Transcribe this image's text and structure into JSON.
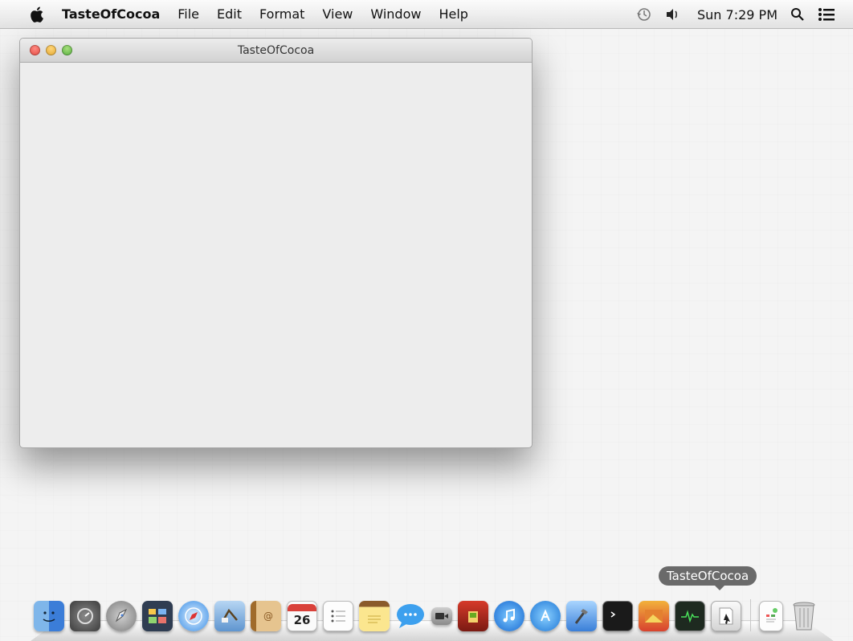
{
  "menubar": {
    "app_name": "TasteOfCocoa",
    "items": [
      "File",
      "Edit",
      "Format",
      "View",
      "Window",
      "Help"
    ],
    "clock": "Sun 7:29 PM"
  },
  "window": {
    "title": "TasteOfCocoa"
  },
  "dock": {
    "tooltip": "TasteOfCocoa",
    "calendar_day": "26",
    "icons": [
      "finder-icon",
      "dashboard-icon",
      "launchpad-icon",
      "mission-control-icon",
      "safari-icon",
      "mail-icon",
      "contacts-icon",
      "calendar-icon",
      "reminders-icon",
      "notes-icon",
      "messages-icon",
      "facetime-icon",
      "photo-booth-icon",
      "itunes-icon",
      "app-store-icon",
      "xcode-icon",
      "terminal-icon",
      "console-icon",
      "activity-monitor-icon",
      "tasteofcocoa-app-icon",
      "document-icon",
      "trash-icon"
    ]
  }
}
